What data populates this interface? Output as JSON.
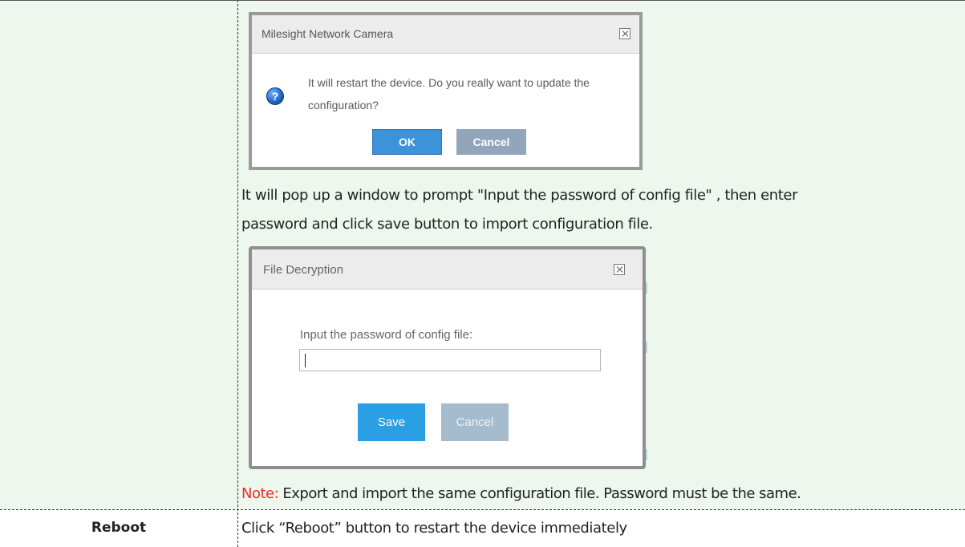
{
  "confirm_dialog": {
    "title": "Milesight Network Camera",
    "message": "It will restart the device. Do you really want to update the configuration?",
    "ok_label": "OK",
    "cancel_label": "Cancel",
    "icon": "question-icon"
  },
  "instructions": {
    "line1": "It will pop up a window to prompt \"Input the password of config file\" , then enter",
    "line2": "password and click save button to import configuration file."
  },
  "decrypt_dialog": {
    "title": "File Decryption",
    "field_label": "Input the password of config file:",
    "password_value": "",
    "save_label": "Save",
    "cancel_label": "Cancel"
  },
  "note": {
    "label": "Note:",
    "text": " Export and import the same configuration file. Password must be the same."
  },
  "table_row": {
    "name": "Reboot",
    "description": "Click “Reboot” button to restart the device immediately"
  },
  "colors": {
    "background": "#eef7ee",
    "note_label": "#ee2a2a",
    "ok_button": "#3b93d9",
    "save_button": "#2a9fe4"
  }
}
